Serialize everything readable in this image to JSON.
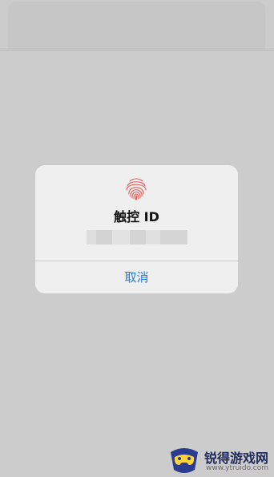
{
  "alert": {
    "title": "触控 ID",
    "cancel_label": "取消"
  },
  "watermark": {
    "brand": "锐得游戏网",
    "url": "www.ytruido.com"
  },
  "colors": {
    "background": "#cccccc",
    "dialog": "#efefef",
    "accent": "#1e7be7",
    "fingerprint": "#e8574f"
  },
  "icons": {
    "alert_icon": "fingerprint-icon",
    "watermark_logo": "controller-logo-icon"
  }
}
